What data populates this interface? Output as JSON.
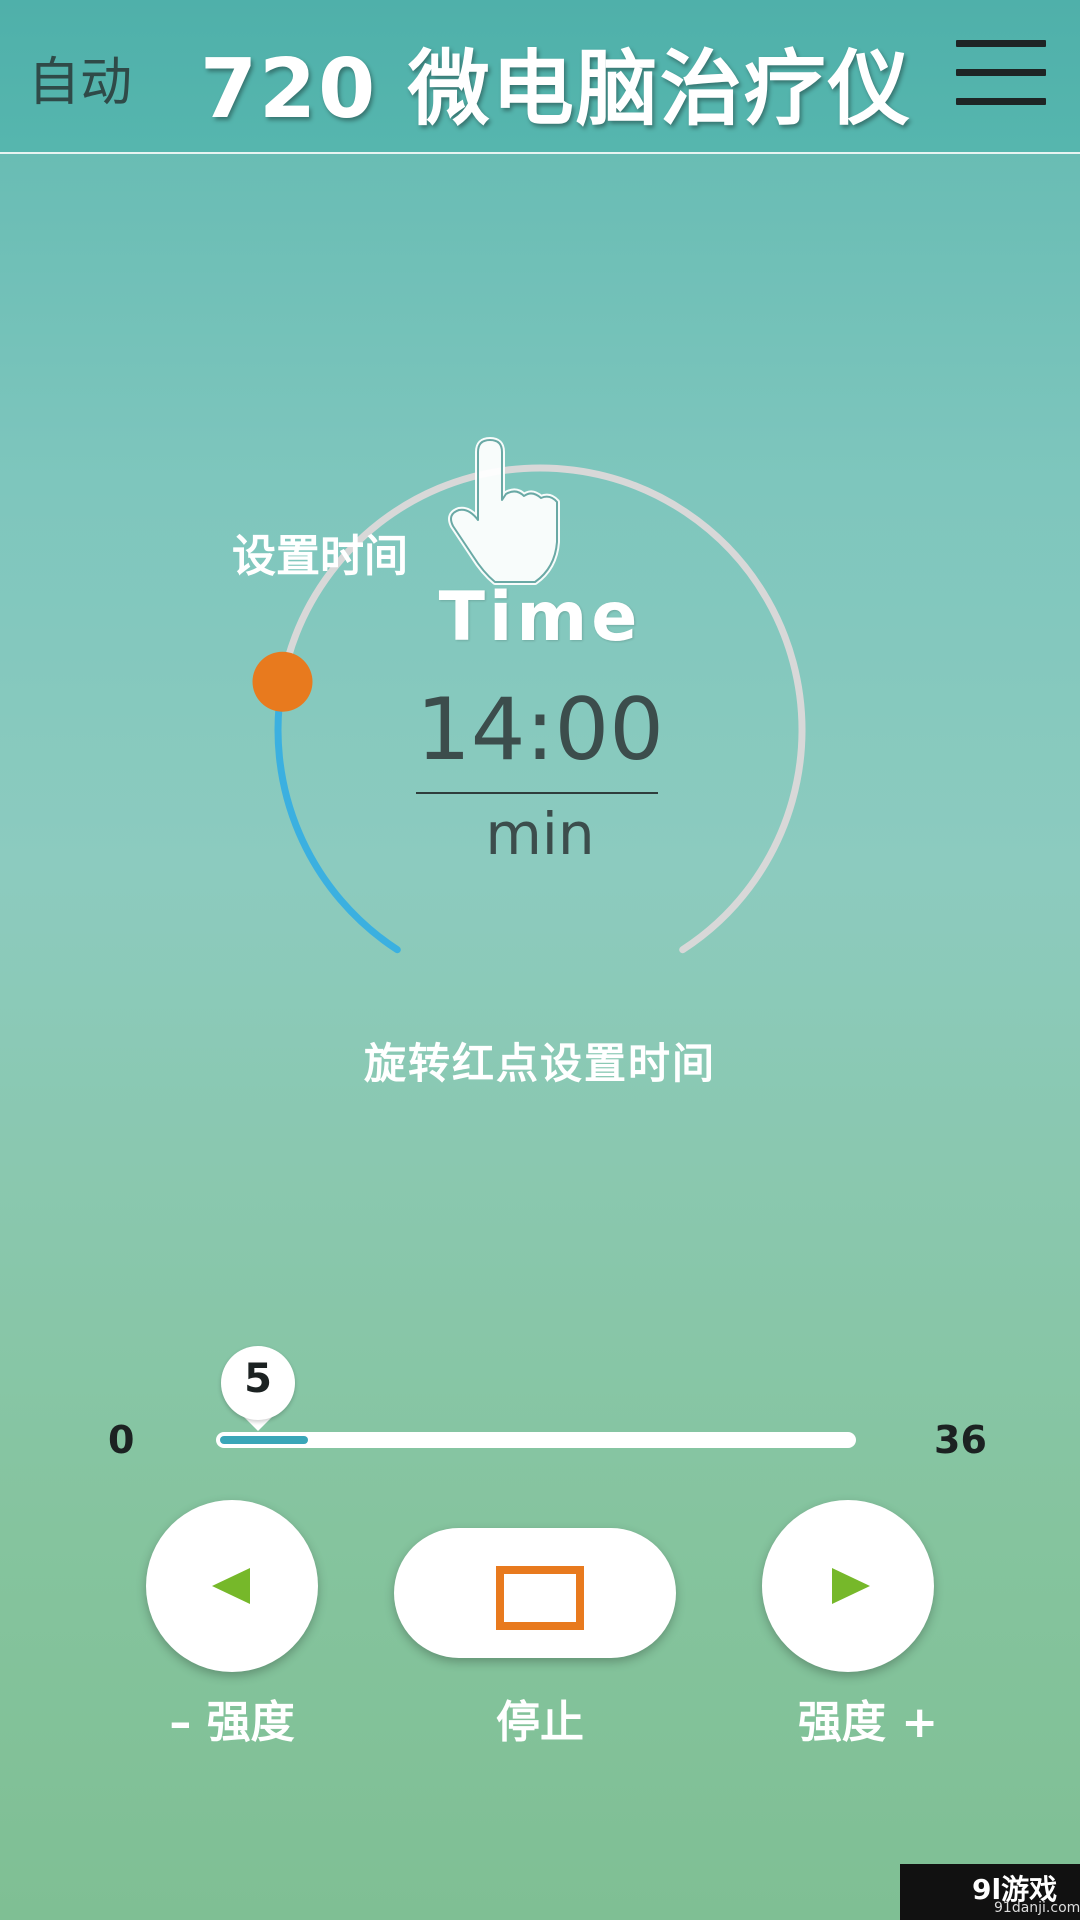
{
  "header": {
    "mode_label": "自动",
    "title": "720 微电脑治疗仪",
    "menu_icon": "hamburger-menu-icon"
  },
  "timer": {
    "set_time_label": "设置时间",
    "time_word": "Time",
    "value": "14:00",
    "unit": "min",
    "hint": "旋转红点设置时间",
    "knob_icon": "pointing-hand-icon",
    "progress_fraction": 0.23,
    "colors": {
      "progress": "#3bb0e0",
      "track": "#d8d8d8",
      "knob": "#e87a1e"
    }
  },
  "intensity": {
    "min": "0",
    "max": "36",
    "value": "5",
    "value_num": 5,
    "max_num": 36
  },
  "controls": {
    "decrease_label": "– 强度",
    "stop_label": "停止",
    "increase_label": "强度 +",
    "colors": {
      "arrow": "#76b82a",
      "stop": "#e87a1e"
    }
  },
  "watermark": {
    "logo": "9l游戏",
    "url": "91danji.com"
  }
}
